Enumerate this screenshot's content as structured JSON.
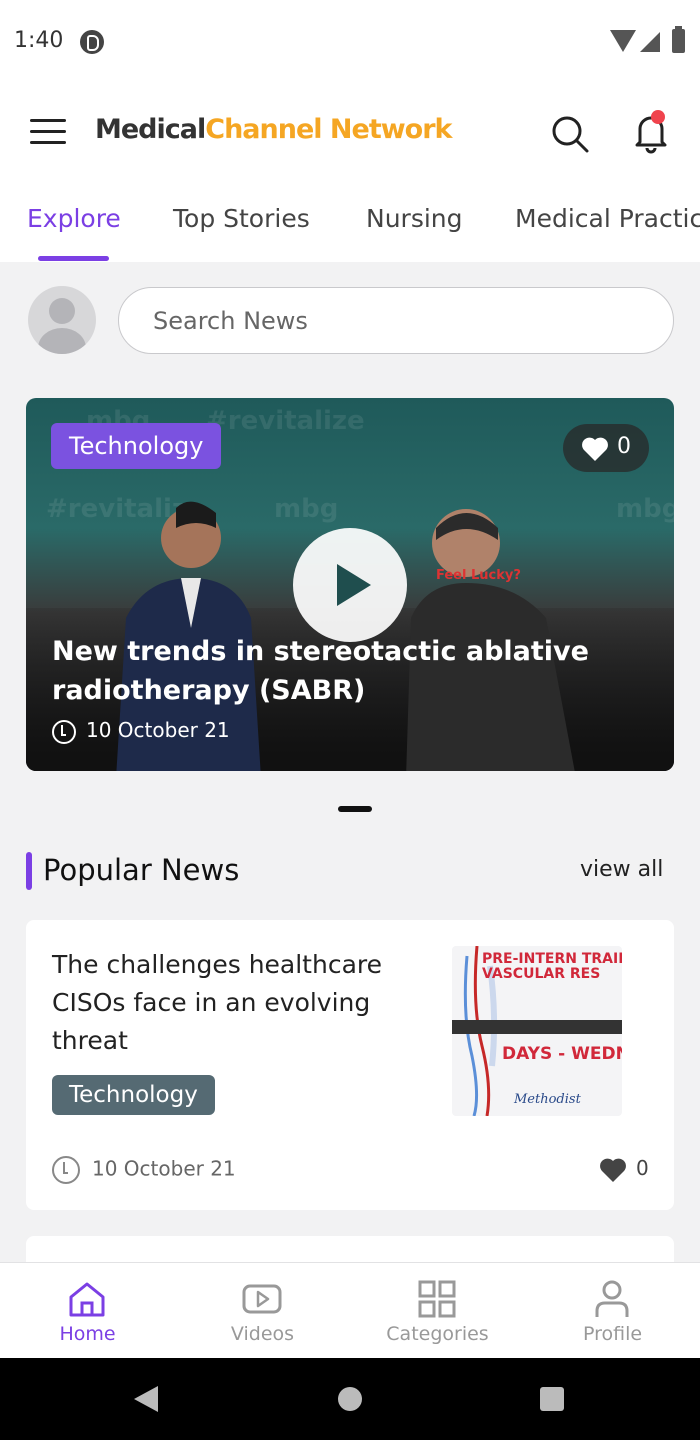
{
  "status_bar": {
    "time": "1:40"
  },
  "header": {
    "brand_part1": "Medical",
    "brand_part2": "Channel Network",
    "brand_colors": {
      "primary": "#333333",
      "accent": "#f5a623"
    },
    "accent_color": "#7b3fe4"
  },
  "tabs": [
    {
      "label": "Explore",
      "active": true
    },
    {
      "label": "Top Stories",
      "active": false
    },
    {
      "label": "Nursing",
      "active": false
    },
    {
      "label": "Medical Practic",
      "active": false
    }
  ],
  "search": {
    "placeholder": "Search News"
  },
  "featured": {
    "category": "Technology",
    "likes": "0",
    "title": "New trends in stereotactic ablative radiotherapy (SABR)",
    "date": "10 October 21",
    "shirt_text": "Feel Lucky?",
    "watermarks": [
      "mbg",
      "#revitalize",
      "mbg",
      "#revitalize",
      "mbg"
    ]
  },
  "popular": {
    "title": "Popular News",
    "view_all": "view all",
    "items": [
      {
        "title": "The challenges healthcare CISOs face in an evolving threat",
        "category": "Technology",
        "date": "10 October 21",
        "likes": "0",
        "thumb_line1": "PRE-INTERN TRAIN",
        "thumb_line2": "VASCULAR RES",
        "thumb_line3": "DAYS - WEDN",
        "thumb_line4": "Methodist"
      }
    ]
  },
  "bottom_nav": [
    {
      "label": "Home",
      "icon": "home-icon",
      "active": true
    },
    {
      "label": "Videos",
      "icon": "video-icon",
      "active": false
    },
    {
      "label": "Categories",
      "icon": "categories-icon",
      "active": false
    },
    {
      "label": "Profile",
      "icon": "profile-icon",
      "active": false
    }
  ]
}
